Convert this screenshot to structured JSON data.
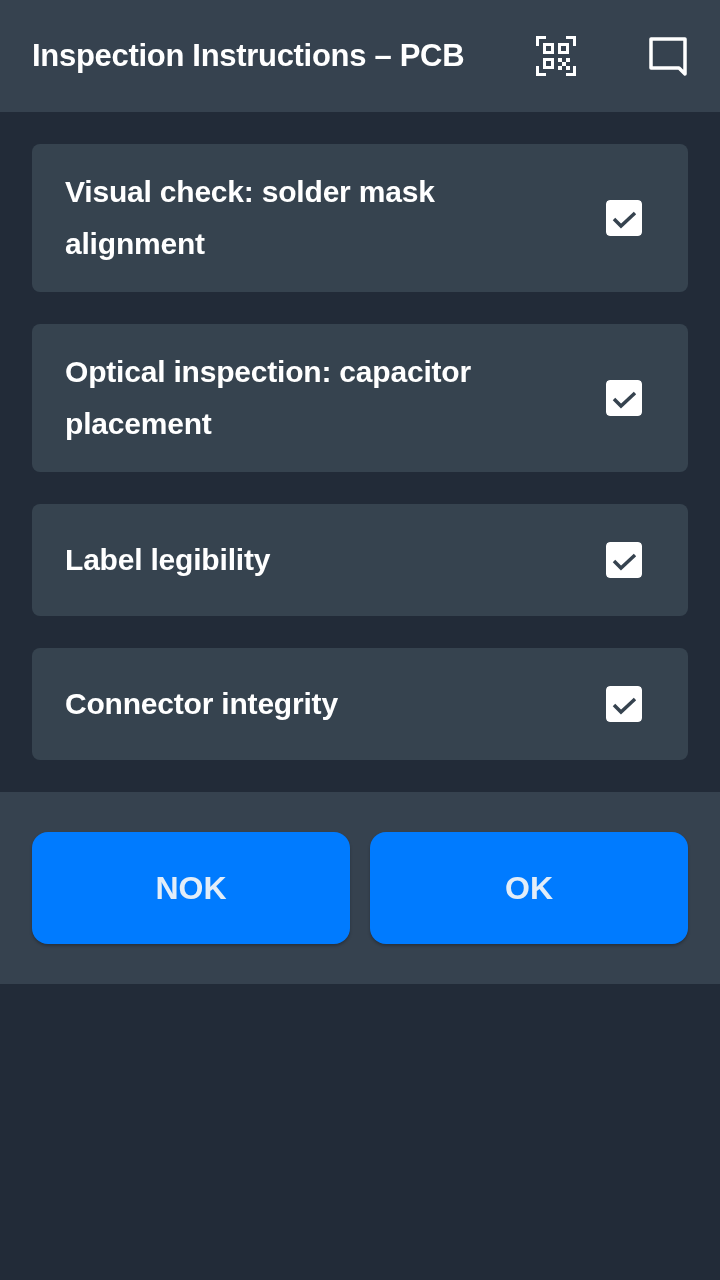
{
  "header": {
    "title": "Inspection Instructions – PCB"
  },
  "checklist": [
    {
      "label": "Visual check: solder mask alignment",
      "checked": true
    },
    {
      "label": "Optical inspection: capacitor placement",
      "checked": true
    },
    {
      "label": "Label legibility",
      "checked": true
    },
    {
      "label": "Connector integrity",
      "checked": true
    }
  ],
  "buttons": [
    {
      "label": "NOK"
    },
    {
      "label": "OK"
    }
  ]
}
